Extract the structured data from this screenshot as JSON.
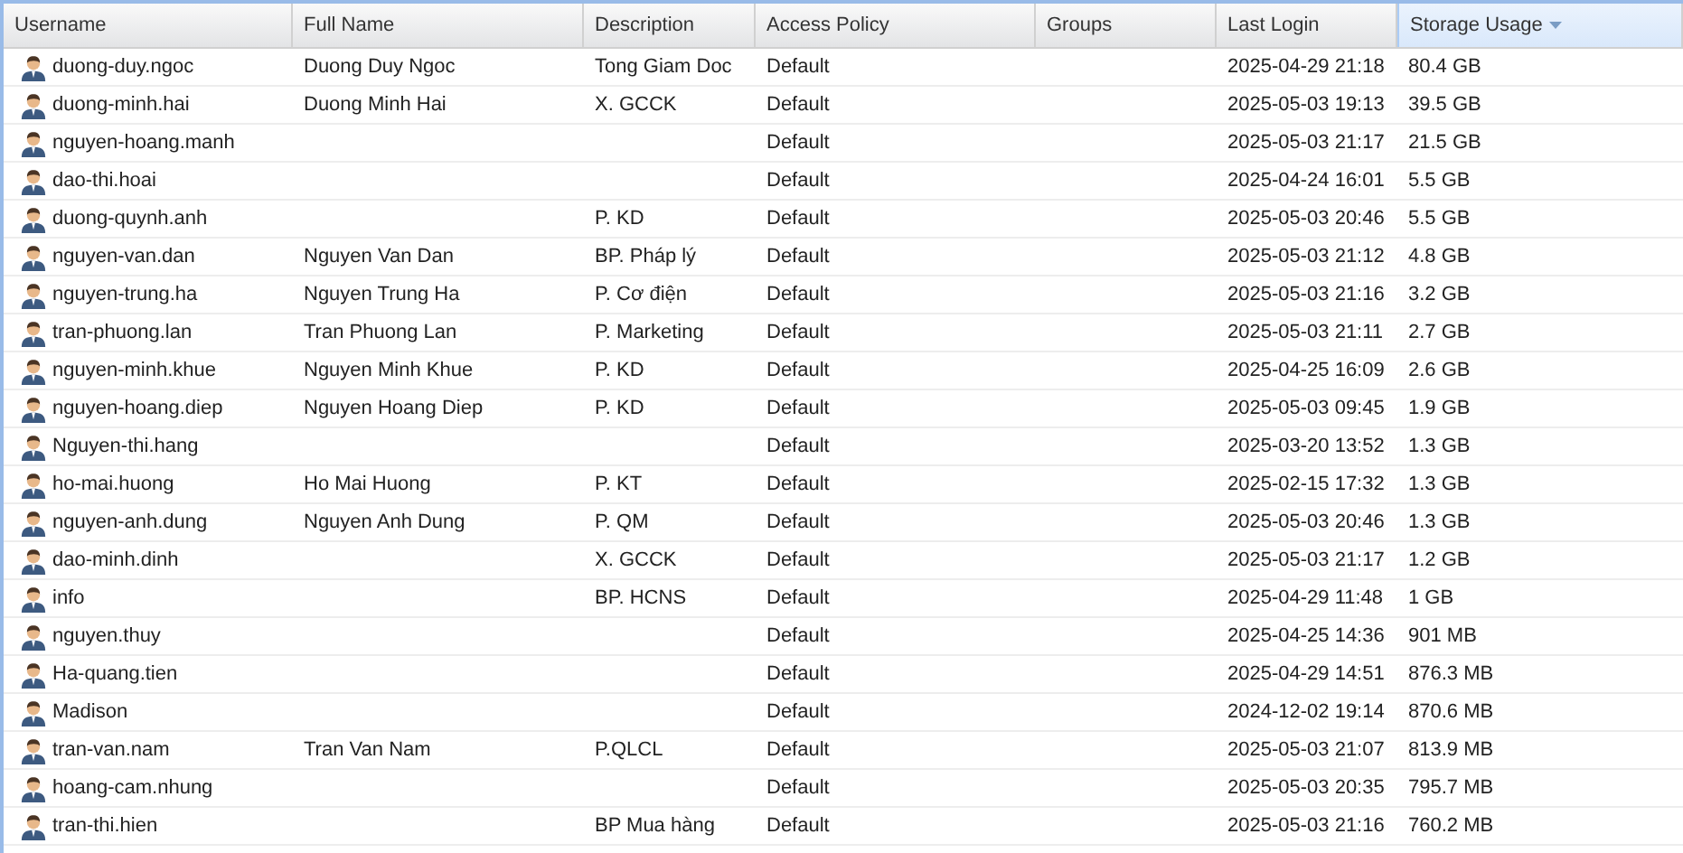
{
  "table": {
    "columns": [
      {
        "label": "Username",
        "sorted": false
      },
      {
        "label": "Full Name",
        "sorted": false
      },
      {
        "label": "Description",
        "sorted": false
      },
      {
        "label": "Access Policy",
        "sorted": false
      },
      {
        "label": "Groups",
        "sorted": false
      },
      {
        "label": "Last Login",
        "sorted": false
      },
      {
        "label": "Storage Usage",
        "sorted": true
      }
    ],
    "rows": [
      {
        "username": "duong-duy.ngoc",
        "full_name": "Duong Duy Ngoc",
        "description": "Tong Giam Doc",
        "access_policy": "Default",
        "last_login": "2025-04-29 21:18",
        "storage_usage": "80.4 GB"
      },
      {
        "username": "duong-minh.hai",
        "full_name": "Duong Minh Hai",
        "description": "X. GCCK",
        "access_policy": "Default",
        "last_login": "2025-05-03 19:13",
        "storage_usage": "39.5 GB"
      },
      {
        "username": "nguyen-hoang.manh",
        "access_policy": "Default",
        "last_login": "2025-05-03 21:17",
        "storage_usage": "21.5 GB"
      },
      {
        "username": "dao-thi.hoai",
        "access_policy": "Default",
        "last_login": "2025-04-24 16:01",
        "storage_usage": "5.5 GB"
      },
      {
        "username": "duong-quynh.anh",
        "description": "P. KD",
        "access_policy": "Default",
        "last_login": "2025-05-03 20:46",
        "storage_usage": "5.5 GB"
      },
      {
        "username": "nguyen-van.dan",
        "full_name": "Nguyen Van Dan",
        "description": "BP. Pháp lý",
        "access_policy": "Default",
        "last_login": "2025-05-03 21:12",
        "storage_usage": "4.8 GB"
      },
      {
        "username": "nguyen-trung.ha",
        "full_name": "Nguyen Trung Ha",
        "description": "P. Cơ điện",
        "access_policy": "Default",
        "last_login": "2025-05-03 21:16",
        "storage_usage": "3.2 GB"
      },
      {
        "username": "tran-phuong.lan",
        "full_name": "Tran Phuong Lan",
        "description": "P. Marketing",
        "access_policy": "Default",
        "last_login": "2025-05-03 21:11",
        "storage_usage": "2.7 GB"
      },
      {
        "username": "nguyen-minh.khue",
        "full_name": "Nguyen Minh Khue",
        "description": "P. KD",
        "access_policy": "Default",
        "last_login": "2025-04-25 16:09",
        "storage_usage": "2.6 GB"
      },
      {
        "username": "nguyen-hoang.diep",
        "full_name": "Nguyen Hoang Diep",
        "description": "P. KD",
        "access_policy": "Default",
        "last_login": "2025-05-03 09:45",
        "storage_usage": "1.9 GB"
      },
      {
        "username": "Nguyen-thi.hang",
        "access_policy": "Default",
        "last_login": "2025-03-20 13:52",
        "storage_usage": "1.3 GB"
      },
      {
        "username": "ho-mai.huong",
        "full_name": "Ho Mai Huong",
        "description": "P. KT",
        "access_policy": "Default",
        "last_login": "2025-02-15 17:32",
        "storage_usage": "1.3 GB"
      },
      {
        "username": "nguyen-anh.dung",
        "full_name": "Nguyen Anh Dung",
        "description": "P. QM",
        "access_policy": "Default",
        "last_login": "2025-05-03 20:46",
        "storage_usage": "1.3 GB"
      },
      {
        "username": "dao-minh.dinh",
        "description": "X. GCCK",
        "access_policy": "Default",
        "last_login": "2025-05-03 21:17",
        "storage_usage": "1.2 GB"
      },
      {
        "username": "info",
        "description": "BP. HCNS",
        "access_policy": "Default",
        "last_login": "2025-04-29 11:48",
        "storage_usage": "1 GB"
      },
      {
        "username": "nguyen.thuy",
        "access_policy": "Default",
        "last_login": "2025-04-25 14:36",
        "storage_usage": "901 MB"
      },
      {
        "username": "Ha-quang.tien",
        "access_policy": "Default",
        "last_login": "2025-04-29 14:51",
        "storage_usage": "876.3 MB"
      },
      {
        "username": "Madison",
        "access_policy": "Default",
        "last_login": "2024-12-02 19:14",
        "storage_usage": "870.6 MB"
      },
      {
        "username": "tran-van.nam",
        "full_name": "Tran Van Nam",
        "description": "P.QLCL",
        "access_policy": "Default",
        "last_login": "2025-05-03 21:07",
        "storage_usage": "813.9 MB"
      },
      {
        "username": "hoang-cam.nhung",
        "access_policy": "Default",
        "last_login": "2025-05-03 20:35",
        "storage_usage": "795.7 MB"
      },
      {
        "username": "tran-thi.hien",
        "description": "BP Mua hàng",
        "access_policy": "Default",
        "last_login": "2025-05-03 21:16",
        "storage_usage": "760.2 MB"
      }
    ]
  }
}
